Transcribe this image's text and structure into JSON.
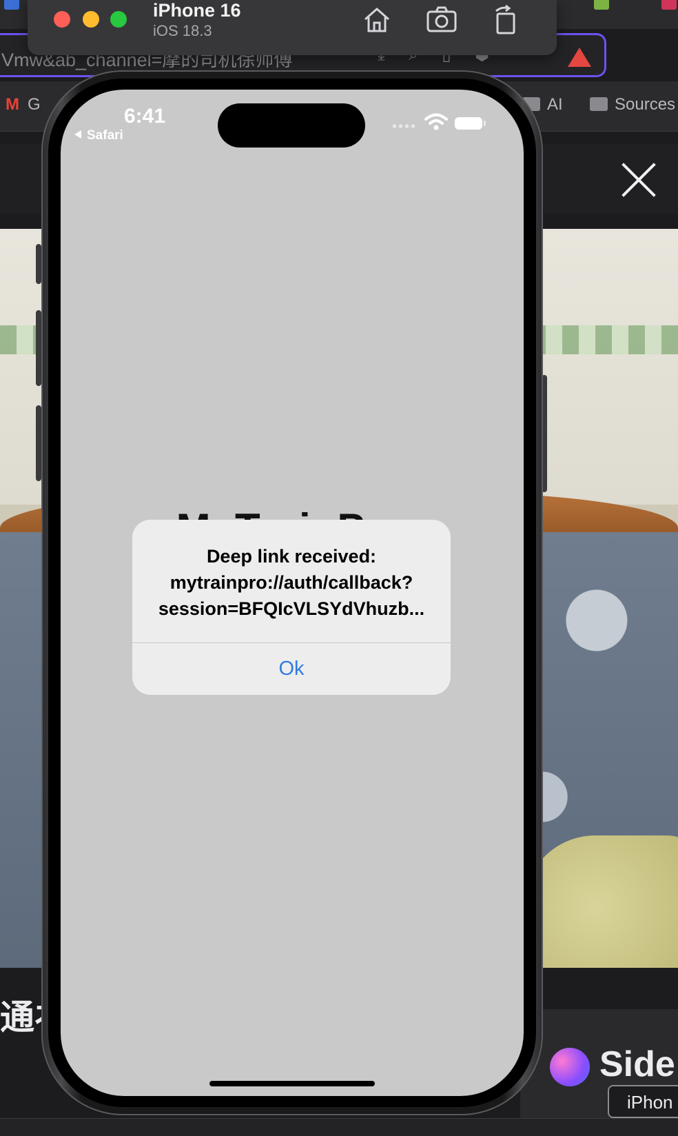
{
  "simulator": {
    "device_name": "iPhone 16",
    "os_version": "iOS 18.3",
    "toolbar_icons": [
      "home-icon",
      "screenshot-icon",
      "rotate-icon"
    ]
  },
  "browser": {
    "url_text": "Vmw&ab_channel=摩的司机徐师傅",
    "bookmarks": [
      "G",
      "AI",
      "Sources"
    ],
    "video_title_partial": "通衤",
    "sider_label": "Side",
    "iphone_chip": "iPhon"
  },
  "phone": {
    "status_time": "6:41",
    "back_label": "Safari",
    "app_title_partial": "MyTrainPro"
  },
  "alert": {
    "message": "Deep link received:\nmytrainpro://auth/callback?\nsession=BFQIcVLSYdVhuzb...",
    "ok_label": "Ok",
    "ok_color": "#2f7be0"
  }
}
